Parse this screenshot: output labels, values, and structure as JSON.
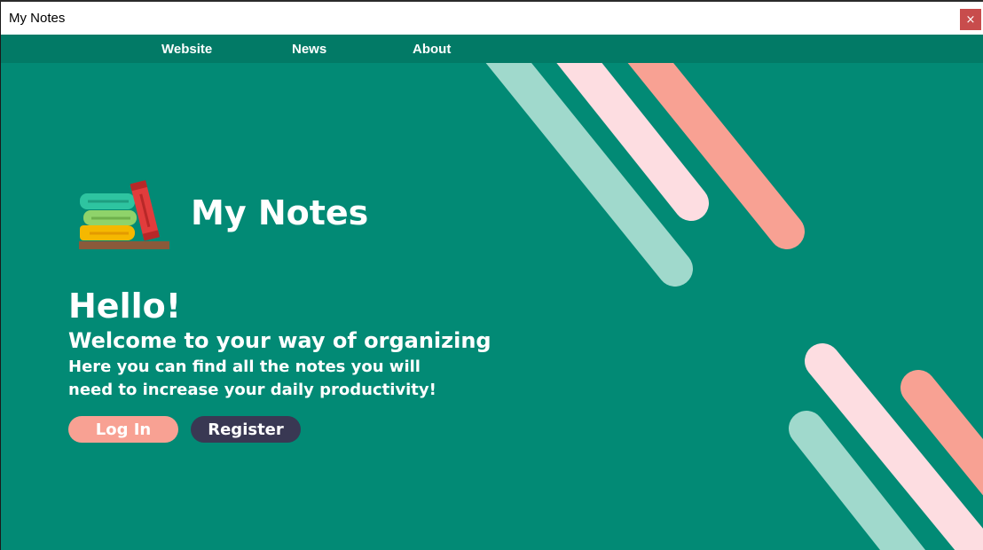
{
  "window": {
    "title": "My Notes",
    "close_label": "×"
  },
  "nav": {
    "items": [
      {
        "label": "Website"
      },
      {
        "label": "News"
      },
      {
        "label": "About"
      }
    ]
  },
  "hero": {
    "app_name": "My Notes",
    "greeting": "Hello!",
    "welcome": "Welcome to your way of organizing",
    "description": "Here you can find all the notes you will need to increase your daily productivity!",
    "login_label": "Log In",
    "register_label": "Register"
  },
  "colors": {
    "background": "#028a75",
    "nav": "#027a66",
    "accent_salmon": "#f8a193",
    "accent_pink": "#fddde1",
    "accent_mint": "#a0d9cc",
    "dark_button": "#393853"
  },
  "icons": {
    "logo": "stacked-books-icon",
    "close": "close-icon"
  }
}
